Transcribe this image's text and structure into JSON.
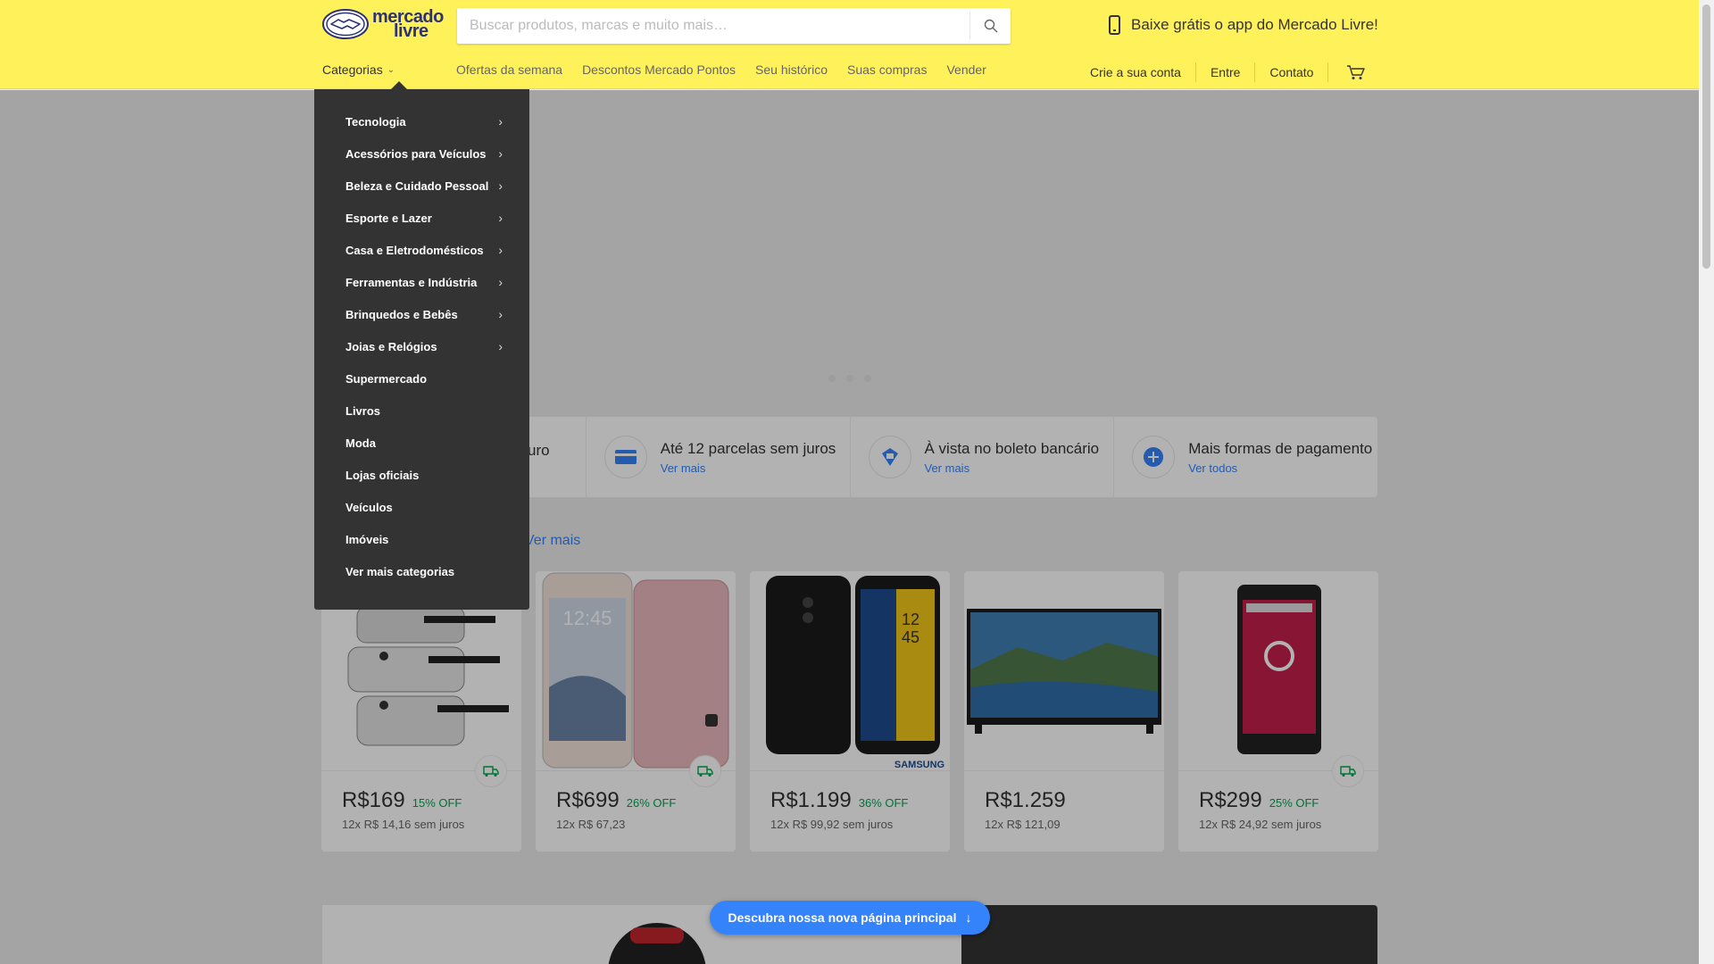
{
  "header": {
    "logo_text_line1": "mercado",
    "logo_text_line2": "livre",
    "search_placeholder": "Buscar produtos, marcas e muito mais…",
    "app_promo": "Baixe grátis o app do Mercado Livre!",
    "colors": {
      "header_bg": "#fff159",
      "brand_blue": "#2d3277",
      "link_blue": "#3483fa",
      "discount_green": "#00a650"
    }
  },
  "nav": {
    "categories_label": "Categorias",
    "links": [
      "Ofertas da semana",
      "Descontos Mercado Pontos",
      "Seu histórico",
      "Suas compras",
      "Vender"
    ],
    "account": [
      "Crie a sua conta",
      "Entre",
      "Contato"
    ]
  },
  "menu": {
    "items": [
      {
        "label": "Tecnologia",
        "has_sub": true
      },
      {
        "label": "Acessórios para Veículos",
        "has_sub": true
      },
      {
        "label": "Beleza e Cuidado Pessoal",
        "has_sub": true
      },
      {
        "label": "Esporte e Lazer",
        "has_sub": true
      },
      {
        "label": "Casa e Eletrodomésticos",
        "has_sub": true
      },
      {
        "label": "Ferramentas e Indústria",
        "has_sub": true
      },
      {
        "label": "Brinquedos e Bebês",
        "has_sub": true
      },
      {
        "label": "Joias e Relógios",
        "has_sub": true
      },
      {
        "label": "Supermercado",
        "has_sub": false
      },
      {
        "label": "Livros",
        "has_sub": false
      },
      {
        "label": "Moda",
        "has_sub": false
      },
      {
        "label": "Lojas oficiais",
        "has_sub": false
      },
      {
        "label": "Veículos",
        "has_sub": false
      },
      {
        "label": "Imóveis",
        "has_sub": false
      },
      {
        "label": "Ver mais categorias",
        "has_sub": false
      }
    ]
  },
  "payments": {
    "partial_text": "uro",
    "items": [
      {
        "title": "Até 12 parcelas sem juros",
        "link": "Ver mais",
        "icon": "credit-card-icon"
      },
      {
        "title": "À vista no boleto bancário",
        "link": "Ver mais",
        "icon": "boleto-icon"
      },
      {
        "title": "Mais formas de pagamento",
        "link": "Ver todos",
        "icon": "plus-icon"
      }
    ]
  },
  "section": {
    "link": "Ver mais"
  },
  "products": [
    {
      "price": "R$169",
      "off": "15% OFF",
      "installments": "12x R$ 14,16 sem juros",
      "free_shipping": true,
      "image": "pressure-cookers"
    },
    {
      "price": "R$699",
      "off": "26% OFF",
      "installments": "12x R$ 67,23",
      "free_shipping": true,
      "image": "samsung-phone-pink"
    },
    {
      "price": "R$1.199",
      "off": "36% OFF",
      "installments": "12x R$ 99,92 sem juros",
      "free_shipping": false,
      "image": "samsung-galaxy-j8"
    },
    {
      "price": "R$1.259",
      "off": "",
      "installments": "12x R$ 121,09",
      "free_shipping": false,
      "image": "samsung-tv"
    },
    {
      "price": "R$299",
      "off": "25% OFF",
      "installments": "12x R$ 24,92 sem juros",
      "free_shipping": true,
      "image": "red-phone"
    }
  ],
  "discover_button": "Descubra nossa nova página principal",
  "carousel": {
    "slides": 3
  }
}
